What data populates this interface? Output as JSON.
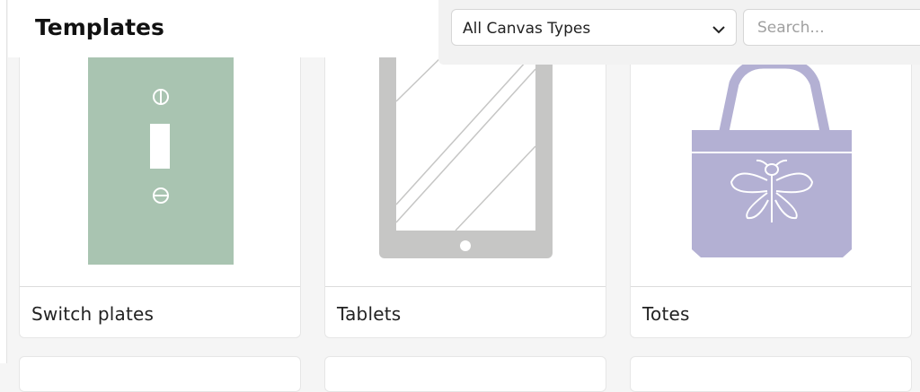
{
  "header": {
    "title": "Templates"
  },
  "filter": {
    "selected": "All Canvas Types"
  },
  "search": {
    "placeholder": "Search..."
  },
  "cards": [
    {
      "label": "Switch plates",
      "art_color": "#a9c4b1"
    },
    {
      "label": "Tablets",
      "art_color": "#c6c6c5"
    },
    {
      "label": "Totes",
      "art_color": "#b3b0d3"
    }
  ]
}
